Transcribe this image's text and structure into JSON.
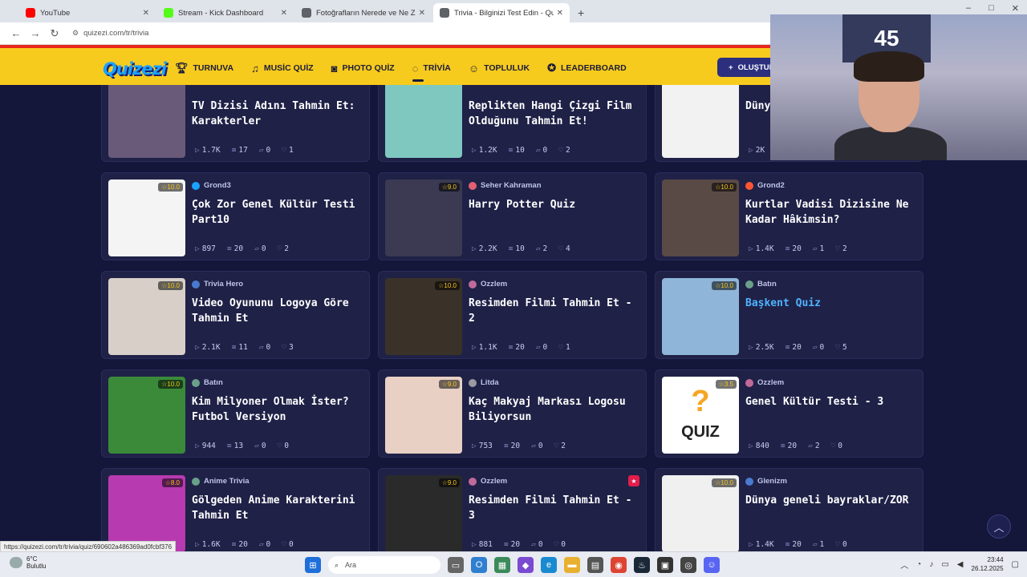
{
  "browser": {
    "tabs": [
      {
        "title": "YouTube",
        "color": "#ff0000",
        "active": false
      },
      {
        "title": "Stream - Kick Dashboard",
        "color": "#53fc18",
        "active": false
      },
      {
        "title": "Fotoğrafların Nerede ve Ne Zam",
        "color": "#5f6368",
        "active": false
      },
      {
        "title": "Trivia - Bilginizi Test Edin - Quiz",
        "color": "#5f6368",
        "active": true
      }
    ],
    "url": "quizezi.com/tr/trivia",
    "status_url": "https://quizezi.com/tr/trivia/quiz/690602a486369ad0fcbf376"
  },
  "site": {
    "logo": "Quizezi",
    "menu": [
      {
        "icon": "trophy-icon",
        "label": "TURNUVA"
      },
      {
        "icon": "music-icon",
        "label": "MUSİC QUİZ"
      },
      {
        "icon": "camera-icon",
        "label": "PHOTO QUİZ"
      },
      {
        "icon": "chat-icon",
        "label": "TRİVİA",
        "active": true
      },
      {
        "icon": "people-icon",
        "label": "TOPLULUK"
      },
      {
        "icon": "award-icon",
        "label": "LEADERBOARD"
      }
    ],
    "create_button": "OLUŞTUR"
  },
  "cards": [
    {
      "author": "",
      "title": "TV Dizisi Adını Tahmin Et: Karakterler",
      "rating": "",
      "plays": "1.7K",
      "questions": "17",
      "comments": "0",
      "likes": "1",
      "thumb": "#6a5a7a"
    },
    {
      "author": "",
      "title": "Replikten Hangi Çizgi Film Olduğunu Tahmin Et!",
      "rating": "",
      "plays": "1.2K",
      "questions": "10",
      "comments": "0",
      "likes": "2",
      "thumb": "#7ec8c0"
    },
    {
      "author": "",
      "title": "Dünya takı",
      "rating": "",
      "plays": "2K",
      "questions": "",
      "comments": "",
      "likes": "",
      "thumb": "#f2f2f2"
    },
    {
      "author": "Grond3",
      "title": "Çok Zor Genel Kültür Testi Part10",
      "rating": "10.0",
      "plays": "897",
      "questions": "20",
      "comments": "0",
      "likes": "2",
      "thumb": "#f4f4f4",
      "avatar": "#1ba1ff"
    },
    {
      "author": "Seher Kahraman",
      "title": "Harry Potter Quiz",
      "rating": "9.0",
      "plays": "2.2K",
      "questions": "10",
      "comments": "2",
      "likes": "4",
      "thumb": "#3b3a52",
      "avatar": "#e06070"
    },
    {
      "author": "Grond2",
      "title": "Kurtlar Vadisi Dizisine Ne Kadar Hâkimsin?",
      "rating": "10.0",
      "plays": "1.4K",
      "questions": "20",
      "comments": "1",
      "likes": "2",
      "thumb": "#5a4a46",
      "avatar": "#ff5533"
    },
    {
      "author": "Trivia Hero",
      "title": "Video Oyununu Logoya Göre Tahmin Et",
      "rating": "10.0",
      "plays": "2.1K",
      "questions": "11",
      "comments": "0",
      "likes": "3",
      "thumb": "#d8d0c8",
      "avatar": "#4a7ad0"
    },
    {
      "author": "Ozzlem",
      "title": "Resimden Filmi Tahmin Et - 2",
      "rating": "10.0",
      "plays": "1.1K",
      "questions": "20",
      "comments": "0",
      "likes": "1",
      "thumb": "#3a3228",
      "avatar": "#c06a9a"
    },
    {
      "author": "Batın",
      "title": "Başkent Quiz",
      "rating": "10.0",
      "plays": "2.5K",
      "questions": "20",
      "comments": "0",
      "likes": "5",
      "thumb": "#8fb6d8",
      "avatar": "#6aa08a",
      "hover": true
    },
    {
      "author": "Batın",
      "title": "Kim Milyoner Olmak İster? Futbol Versiyon",
      "rating": "10.0",
      "plays": "944",
      "questions": "13",
      "comments": "0",
      "likes": "0",
      "thumb": "#3a8a3a",
      "avatar": "#6aa08a"
    },
    {
      "author": "Litda",
      "title": "Kaç Makyaj Markası Logosu Biliyorsun",
      "rating": "9.0",
      "plays": "753",
      "questions": "20",
      "comments": "0",
      "likes": "2",
      "thumb": "#e8d0c4",
      "avatar": "#9a9aa0"
    },
    {
      "author": "Ozzlem",
      "title": "Genel Kültür Testi - 3",
      "rating": "3.5",
      "plays": "840",
      "questions": "20",
      "comments": "2",
      "likes": "0",
      "thumb": "#ffffff",
      "avatar": "#c06a9a",
      "quiz_thumb": "QUIZ"
    },
    {
      "author": "Anime Trivia",
      "title": "Gölgeden Anime Karakterini Tahmin Et",
      "rating": "8.0",
      "plays": "1.6K",
      "questions": "20",
      "comments": "0",
      "likes": "0",
      "thumb": "#b83ab0",
      "avatar": "#6aa08a"
    },
    {
      "author": "Ozzlem",
      "title": "Resimden Filmi Tahmin Et - 3",
      "rating": "9.0",
      "plays": "881",
      "questions": "20",
      "comments": "0",
      "likes": "0",
      "thumb": "#2a2a2a",
      "avatar": "#c06a9a",
      "badge": true
    },
    {
      "author": "Glenizm",
      "title": "Dünya geneli bayraklar/ZOR",
      "rating": "10.0",
      "plays": "1.4K",
      "questions": "20",
      "comments": "1",
      "likes": "0",
      "thumb": "#f0f0f0",
      "avatar": "#4a7ad0"
    }
  ],
  "taskbar": {
    "weather_temp": "6°C",
    "weather_desc": "Bulutlu",
    "search_placeholder": "Ara",
    "time": "23:44",
    "date": "26.12.2025"
  },
  "webcam": {
    "jersey_number": "45"
  }
}
